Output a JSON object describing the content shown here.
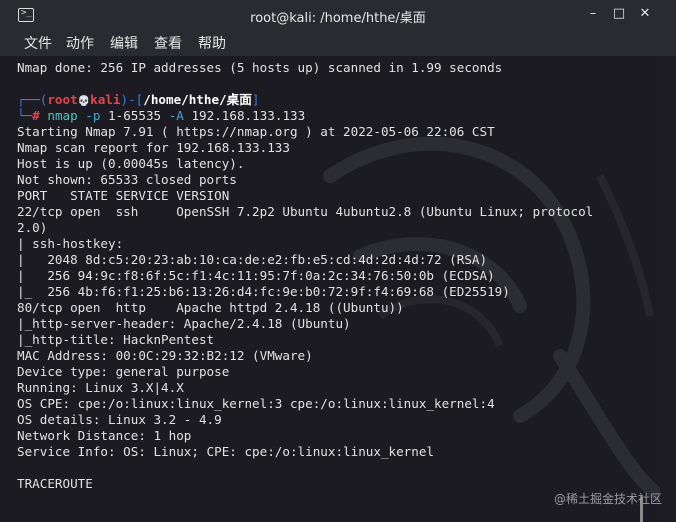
{
  "window": {
    "title": "root@kali: /home/hthe/桌面",
    "controls": {
      "minimize": "–",
      "maximize": "□",
      "close": "✕"
    }
  },
  "menu": [
    "文件",
    "动作",
    "编辑",
    "查看",
    "帮助"
  ],
  "terminal": {
    "prev_line": "Nmap done: 256 IP addresses (5 hosts up) scanned in 1.99 seconds",
    "prompt": {
      "open": "┌──(",
      "user": "root",
      "skull": "💀",
      "host": "kali",
      "sep": ")-[",
      "path": "/home/hthe/桌面",
      "close": "]",
      "second_open": "└─",
      "hash": "#",
      "command": "nmap",
      "args": [
        " -p ",
        "1-65535",
        " -A ",
        "192.168.133.133"
      ]
    },
    "output": [
      "Starting Nmap 7.91 ( https://nmap.org ) at 2022-05-06 22:06 CST",
      "Nmap scan report for 192.168.133.133",
      "Host is up (0.00045s latency).",
      "Not shown: 65533 closed ports",
      "PORT   STATE SERVICE VERSION",
      "22/tcp open  ssh     OpenSSH 7.2p2 Ubuntu 4ubuntu2.8 (Ubuntu Linux; protocol",
      "2.0)",
      "| ssh-hostkey:",
      "|   2048 8d:c5:20:23:ab:10:ca:de:e2:fb:e5:cd:4d:2d:4d:72 (RSA)",
      "|   256 94:9c:f8:6f:5c:f1:4c:11:95:7f:0a:2c:34:76:50:0b (ECDSA)",
      "|_  256 4b:f6:f1:25:b6:13:26:d4:fc:9e:b0:72:9f:f4:69:68 (ED25519)",
      "80/tcp open  http    Apache httpd 2.4.18 ((Ubuntu))",
      "|_http-server-header: Apache/2.4.18 (Ubuntu)",
      "|_http-title: HacknPentest",
      "MAC Address: 00:0C:29:32:B2:12 (VMware)",
      "Device type: general purpose",
      "Running: Linux 3.X|4.X",
      "OS CPE: cpe:/o:linux:linux_kernel:3 cpe:/o:linux:linux_kernel:4",
      "OS details: Linux 3.2 - 4.9",
      "Network Distance: 1 hop",
      "Service Info: OS: Linux; CPE: cpe:/o:linux:linux_kernel",
      "",
      "TRACEROUTE"
    ]
  },
  "watermark": "@稀土掘金技术社区",
  "colors": {
    "background": "#1b1b21",
    "text": "#e2e2e2",
    "prompt_frame": "#3d7bd8",
    "root_user": "#e0464b",
    "command": "#4fc3c8",
    "args": "#3fa7d6"
  }
}
